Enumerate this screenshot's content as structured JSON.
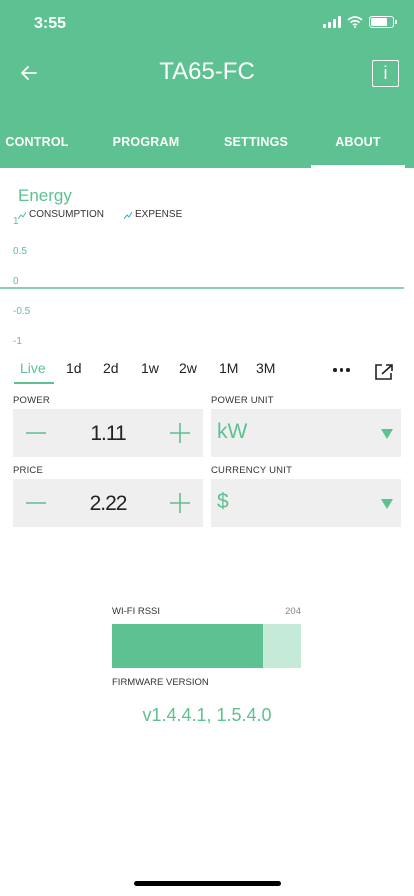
{
  "status_bar": {
    "time": "3:55"
  },
  "header": {
    "title": "TA65-FC",
    "info_glyph": "i"
  },
  "tabs": [
    {
      "label": "CONTROL",
      "active": false
    },
    {
      "label": "PROGRAM",
      "active": false
    },
    {
      "label": "SETTINGS",
      "active": false
    },
    {
      "label": "ABOUT",
      "active": true
    }
  ],
  "energy": {
    "title": "Energy",
    "legend": [
      "CONSUMPTION",
      "EXPENSE"
    ]
  },
  "chart_data": {
    "type": "line",
    "title": "Energy",
    "series": [
      {
        "name": "CONSUMPTION",
        "values": [
          0,
          0
        ]
      },
      {
        "name": "EXPENSE",
        "values": [
          0,
          0
        ]
      }
    ],
    "y_ticks": [
      "1",
      "0.5",
      "0",
      "-0.5",
      "-1"
    ],
    "ylim": [
      -1,
      1
    ],
    "grid": false,
    "legend_position": "top-left"
  },
  "time_ranges": [
    "Live",
    "1d",
    "2d",
    "1w",
    "2w",
    "1M",
    "3M"
  ],
  "active_time_range": "Live",
  "power": {
    "label": "POWER",
    "value": "1.11"
  },
  "power_unit": {
    "label": "POWER UNIT",
    "value": "kW"
  },
  "price": {
    "label": "PRICE",
    "value": "2.22"
  },
  "currency_unit": {
    "label": "CURRENCY UNIT",
    "value": "$"
  },
  "wifi": {
    "label": "WI-FI RSSI",
    "value": "204",
    "fill_fraction": 0.8
  },
  "firmware": {
    "label": "FIRMWARE VERSION",
    "value": "v1.4.4.1, 1.5.4.0"
  },
  "colors": {
    "accent": "#5ec192",
    "accent_light": "#c5ebd8",
    "chart_line": "#3aa6c9",
    "field_bg": "#efefef"
  }
}
